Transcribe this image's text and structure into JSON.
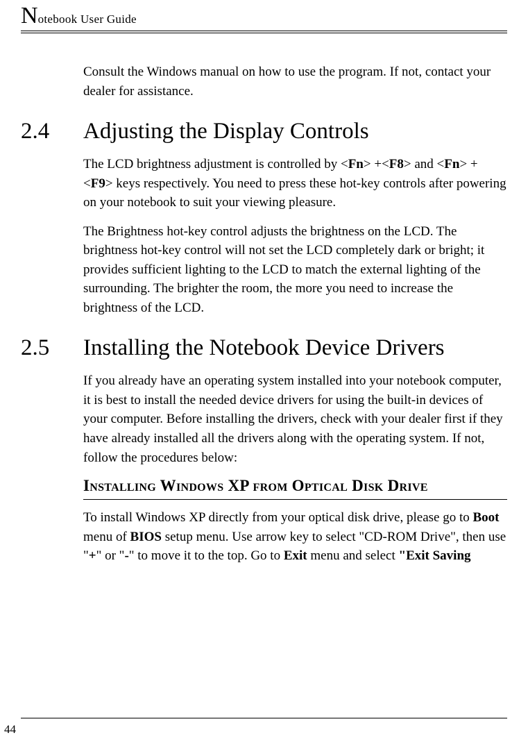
{
  "header": {
    "dropcap": "N",
    "title_rest": "otebook User Guide"
  },
  "intro_para": "Consult the Windows manual on how to use the program. If not, contact your dealer for assistance.",
  "sections": [
    {
      "number": "2.4",
      "title": "Adjusting the Display Controls",
      "paragraphs": [
        {
          "runs": [
            {
              "t": "The LCD brightness adjustment is controlled by <"
            },
            {
              "t": "Fn",
              "b": true
            },
            {
              "t": "> +<"
            },
            {
              "t": "F8",
              "b": true
            },
            {
              "t": "> and <"
            },
            {
              "t": "Fn",
              "b": true
            },
            {
              "t": "> + <"
            },
            {
              "t": "F9",
              "b": true
            },
            {
              "t": "> keys respectively. You need to press these hot-key controls after powering on your notebook to suit your viewing pleasure."
            }
          ]
        },
        {
          "runs": [
            {
              "t": "The Brightness hot-key control adjusts the brightness on the LCD. The brightness hot-key control will not set the LCD completely dark or bright; it provides sufficient lighting to the LCD to match the external lighting of the surrounding. The brighter the room, the more you need to increase the brightness of the LCD."
            }
          ]
        }
      ]
    },
    {
      "number": "2.5",
      "title": "Installing the Notebook Device Drivers",
      "paragraphs": [
        {
          "runs": [
            {
              "t": "If you already have an operating system installed into your notebook computer, it is best to install the needed device drivers for using the built-in devices of your computer. Before installing the drivers, check with your dealer first if they have already installed all the drivers along with the operating system. If not, follow the procedures below:"
            }
          ]
        }
      ],
      "subsections": [
        {
          "heading": "Installing Windows XP from Optical Disk Drive",
          "paragraphs": [
            {
              "runs": [
                {
                  "t": "To install Windows XP directly from your optical disk drive, please go to "
                },
                {
                  "t": "Boot",
                  "b": true
                },
                {
                  "t": " menu of "
                },
                {
                  "t": "BIOS",
                  "b": true
                },
                {
                  "t": " setup menu. Use arrow key to select \"CD-ROM Drive\", then use \""
                },
                {
                  "t": "+",
                  "b": true
                },
                {
                  "t": "\" or \""
                },
                {
                  "t": "-",
                  "b": true
                },
                {
                  "t": "\" to move it to the top. Go to "
                },
                {
                  "t": "Exit",
                  "b": true
                },
                {
                  "t": " menu and select "
                },
                {
                  "t": "\"Exit Saving",
                  "b": true
                }
              ]
            }
          ]
        }
      ]
    }
  ],
  "footer": {
    "page_number": "44"
  }
}
